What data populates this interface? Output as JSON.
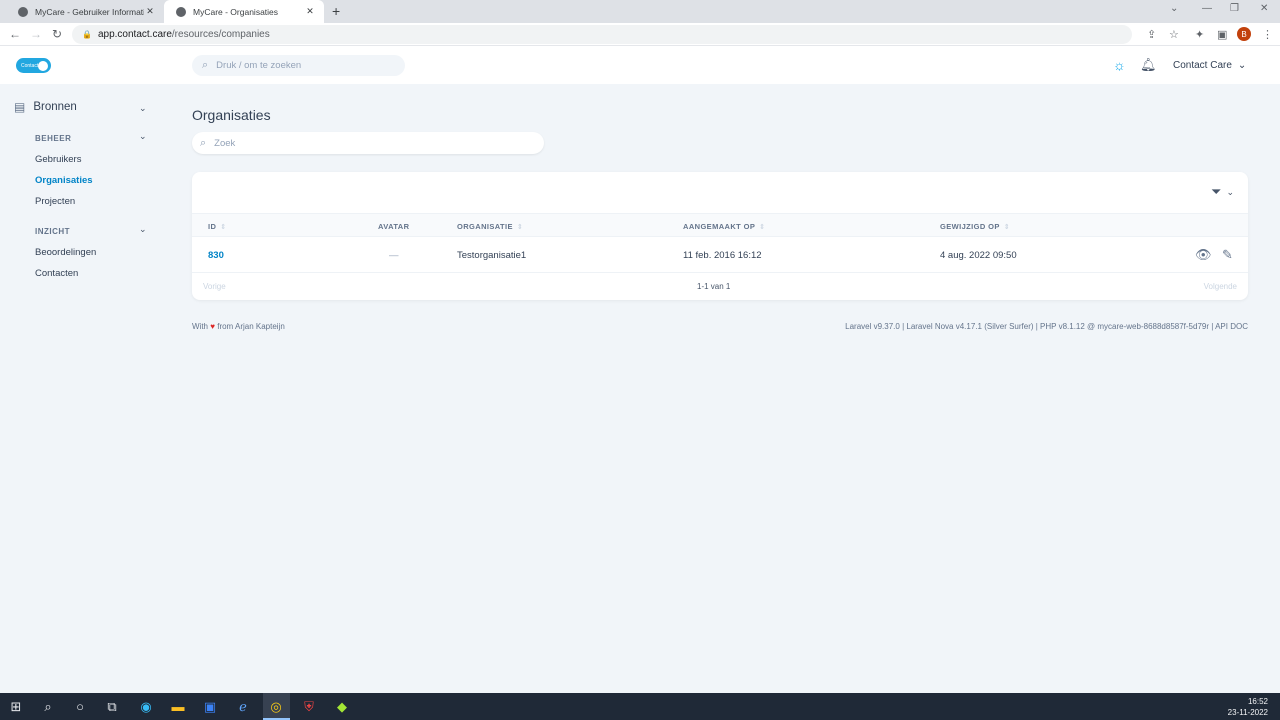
{
  "browser": {
    "tabs": [
      {
        "title": "MyCare - Gebruiker Informatie: C",
        "close": "✕"
      },
      {
        "title": "MyCare - Organisaties",
        "close": "✕"
      }
    ],
    "new_tab": "+",
    "url_host": "app.contact.care",
    "url_path": "/resources/companies",
    "profile_initial": "B"
  },
  "header": {
    "logo_text": "Contact",
    "search_placeholder": "Druk / om te zoeken",
    "user_name": "Contact Care"
  },
  "sidebar": {
    "section_title": "Bronnen",
    "groups": [
      {
        "label": "BEHEER",
        "items": [
          "Gebruikers",
          "Organisaties",
          "Projecten"
        ]
      },
      {
        "label": "INZICHT",
        "items": [
          "Beoordelingen",
          "Contacten"
        ]
      }
    ],
    "active_item": "Organisaties"
  },
  "main": {
    "title": "Organisaties",
    "search_placeholder": "Zoek",
    "table": {
      "columns": [
        "ID",
        "AVATAR",
        "ORGANISATIE",
        "AANGEMAAKT OP",
        "GEWIJZIGD OP"
      ],
      "rows": [
        {
          "id": "830",
          "avatar": "—",
          "organisatie": "Testorganisatie1",
          "aangemaakt": "11 feb. 2016 16:12",
          "gewijzigd": "4 aug. 2022 09:50"
        }
      ]
    },
    "pagination": {
      "prev": "Vorige",
      "status": "1-1 van 1",
      "next": "Volgende"
    }
  },
  "footer": {
    "left_prefix": "With",
    "heart": "♥",
    "left_suffix": "from Arjan Kapteijn",
    "right": "Laravel v9.37.0 | Laravel Nova v4.17.1 (Silver Surfer) | PHP v8.1.12 @ mycare-web-8688d8587f-5d79r | API DOC"
  },
  "taskbar": {
    "time": "16:52",
    "date": "23-11-2022"
  },
  "colors": {
    "accent": "#0284c7",
    "background": "#f1f5f9",
    "logo": "#22a7e0"
  }
}
